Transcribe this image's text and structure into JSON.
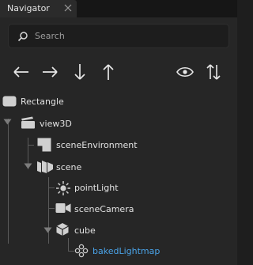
{
  "tab": {
    "title": "Navigator"
  },
  "search": {
    "placeholder": "Search"
  },
  "toolbar": {
    "buttons": [
      {
        "name": "move-left",
        "icon": "arrow-left-icon"
      },
      {
        "name": "move-right",
        "icon": "arrow-right-icon"
      },
      {
        "name": "move-down",
        "icon": "arrow-down-icon"
      },
      {
        "name": "move-up",
        "icon": "arrow-up-icon"
      },
      {
        "name": "visibility-filter",
        "icon": "eye-icon"
      },
      {
        "name": "reverse-order",
        "icon": "sort-arrows-icon"
      }
    ]
  },
  "tree": {
    "items": [
      {
        "label": "Rectangle",
        "icon": "rectangle-icon",
        "depth": 0
      },
      {
        "label": "view3D",
        "icon": "view3d-icon",
        "depth": 0,
        "expanded": true
      },
      {
        "label": "sceneEnvironment",
        "icon": "scene-environment-icon",
        "depth": 1
      },
      {
        "label": "scene",
        "icon": "scene-icon",
        "depth": 1,
        "expanded": true
      },
      {
        "label": "pointLight",
        "icon": "point-light-icon",
        "depth": 2
      },
      {
        "label": "sceneCamera",
        "icon": "camera-icon",
        "depth": 2
      },
      {
        "label": "cube",
        "icon": "cube-icon",
        "depth": 2,
        "expanded": true
      },
      {
        "label": "bakedLightmap",
        "icon": "baked-lightmap-icon",
        "depth": 3,
        "selected": true
      }
    ]
  },
  "colors": {
    "background": "#262626",
    "tabbar": "#161616",
    "text": "#e2e2e2",
    "selected_text": "#4aa3e8",
    "icon": "#d0d0d0"
  }
}
